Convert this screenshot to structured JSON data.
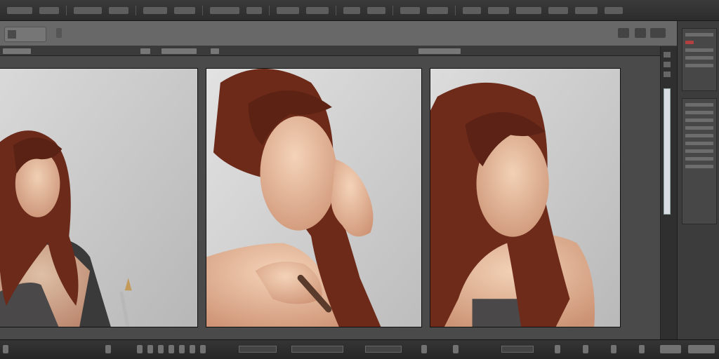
{
  "app": {
    "accent": "#b34040",
    "canvas_bg": "#c8c8c8",
    "panel_bg": "#3c3c3c"
  },
  "images": [
    {
      "subject": "woman-with-pencil"
    },
    {
      "subject": "woman-touching-face"
    },
    {
      "subject": "woman-looking-down"
    }
  ]
}
